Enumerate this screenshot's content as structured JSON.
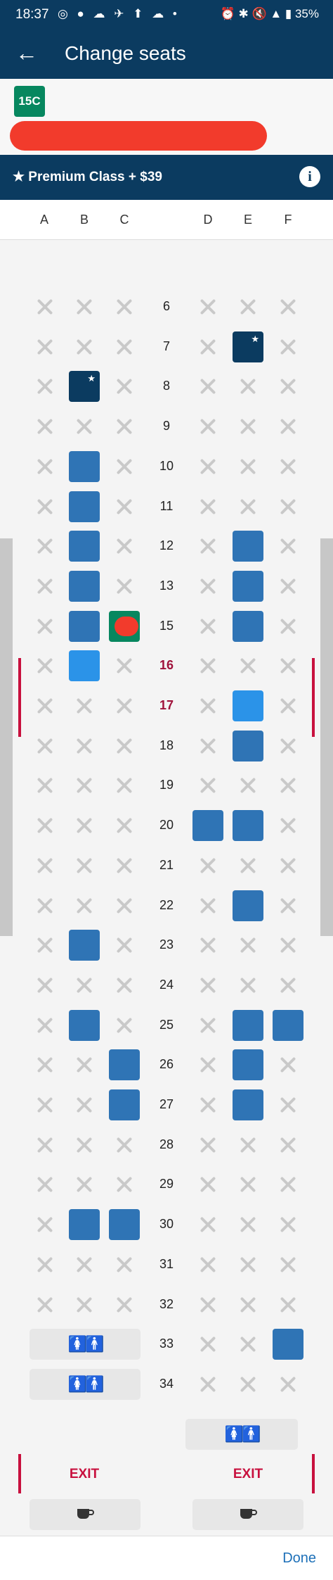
{
  "status": {
    "time": "18:37",
    "icons_left": "◎ ● ☁ ✈ ⬆ ☁ •",
    "icons_right": "⏰ ✱ 🔇 ▲ ▮ 35%"
  },
  "appbar": {
    "title": "Change seats",
    "back_icon": "arrow-left"
  },
  "passenger": {
    "seat": "15C"
  },
  "class_bar": {
    "label": "★ Premium Class + $39",
    "info": "i"
  },
  "columns": [
    "A",
    "B",
    "C",
    "D",
    "E",
    "F"
  ],
  "rows": [
    {
      "num": "6",
      "seats": [
        "x",
        "x",
        "x",
        "x",
        "x",
        "x"
      ]
    },
    {
      "num": "7",
      "seats": [
        "x",
        "x",
        "x",
        "x",
        "dark-star",
        "x"
      ]
    },
    {
      "num": "8",
      "seats": [
        "x",
        "dark-star",
        "x",
        "x",
        "x",
        "x"
      ]
    },
    {
      "num": "9",
      "seats": [
        "x",
        "x",
        "x",
        "x",
        "x",
        "x"
      ]
    },
    {
      "num": "10",
      "seats": [
        "x",
        "avail",
        "x",
        "x",
        "x",
        "x"
      ]
    },
    {
      "num": "11",
      "seats": [
        "x",
        "avail",
        "x",
        "x",
        "x",
        "x"
      ]
    },
    {
      "num": "12",
      "seats": [
        "x",
        "avail",
        "x",
        "x",
        "avail",
        "x"
      ]
    },
    {
      "num": "13",
      "seats": [
        "x",
        "avail",
        "x",
        "x",
        "avail",
        "x"
      ]
    },
    {
      "num": "15",
      "seats": [
        "x",
        "avail",
        "selected",
        "x",
        "avail",
        "x"
      ]
    },
    {
      "num": "16",
      "exit": true,
      "seats": [
        "x",
        "light",
        "x",
        "x",
        "x",
        "x"
      ]
    },
    {
      "num": "17",
      "exit": true,
      "seats": [
        "x",
        "x",
        "x",
        "x",
        "light",
        "x"
      ]
    },
    {
      "num": "18",
      "seats": [
        "x",
        "x",
        "x",
        "x",
        "avail",
        "x"
      ]
    },
    {
      "num": "19",
      "seats": [
        "x",
        "x",
        "x",
        "x",
        "x",
        "x"
      ]
    },
    {
      "num": "20",
      "seats": [
        "x",
        "x",
        "x",
        "avail",
        "avail",
        "x"
      ]
    },
    {
      "num": "21",
      "seats": [
        "x",
        "x",
        "x",
        "x",
        "x",
        "x"
      ]
    },
    {
      "num": "22",
      "seats": [
        "x",
        "x",
        "x",
        "x",
        "avail",
        "x"
      ]
    },
    {
      "num": "23",
      "seats": [
        "x",
        "avail",
        "x",
        "x",
        "x",
        "x"
      ]
    },
    {
      "num": "24",
      "seats": [
        "x",
        "x",
        "x",
        "x",
        "x",
        "x"
      ]
    },
    {
      "num": "25",
      "seats": [
        "x",
        "avail",
        "x",
        "x",
        "avail",
        "avail"
      ]
    },
    {
      "num": "26",
      "seats": [
        "x",
        "x",
        "avail",
        "x",
        "avail",
        "x"
      ]
    },
    {
      "num": "27",
      "seats": [
        "x",
        "x",
        "avail",
        "x",
        "avail",
        "x"
      ]
    },
    {
      "num": "28",
      "seats": [
        "x",
        "x",
        "x",
        "x",
        "x",
        "x"
      ]
    },
    {
      "num": "29",
      "seats": [
        "x",
        "x",
        "x",
        "x",
        "x",
        "x"
      ]
    },
    {
      "num": "30",
      "seats": [
        "x",
        "avail",
        "avail",
        "x",
        "x",
        "x"
      ]
    },
    {
      "num": "31",
      "seats": [
        "x",
        "x",
        "x",
        "x",
        "x",
        "x"
      ]
    },
    {
      "num": "32",
      "seats": [
        "x",
        "x",
        "x",
        "x",
        "x",
        "x"
      ]
    },
    {
      "num": "33",
      "lav_left": true,
      "seats": [
        null,
        null,
        null,
        "x",
        "x",
        "avail"
      ]
    },
    {
      "num": "34",
      "lav_left": true,
      "seats": [
        null,
        null,
        null,
        "x",
        "x",
        "x"
      ]
    }
  ],
  "exit": {
    "left_label": "EXIT",
    "right_label": "EXIT"
  },
  "footer": {
    "done_label": "Done"
  }
}
